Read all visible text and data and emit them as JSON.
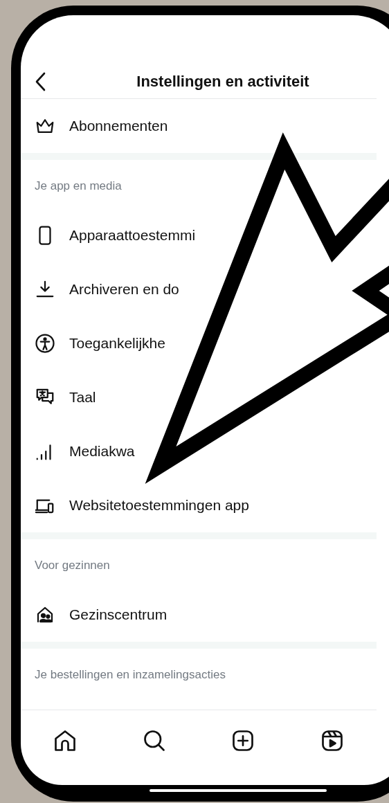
{
  "header": {
    "title": "Instellingen en activiteit"
  },
  "sections": [
    {
      "items": [
        "Abonnementen"
      ]
    },
    {
      "heading": "Je app en media",
      "items": [
        "Apparaattoestemmi",
        "Archiveren en do",
        "Toegankelijkhe",
        "Taal",
        "Mediakwa",
        "Websitetoestemmingen app"
      ]
    },
    {
      "heading": "Voor gezinnen",
      "items": [
        "Gezinscentrum"
      ]
    },
    {
      "heading": "Je bestellingen en inzamelingsacties"
    }
  ]
}
